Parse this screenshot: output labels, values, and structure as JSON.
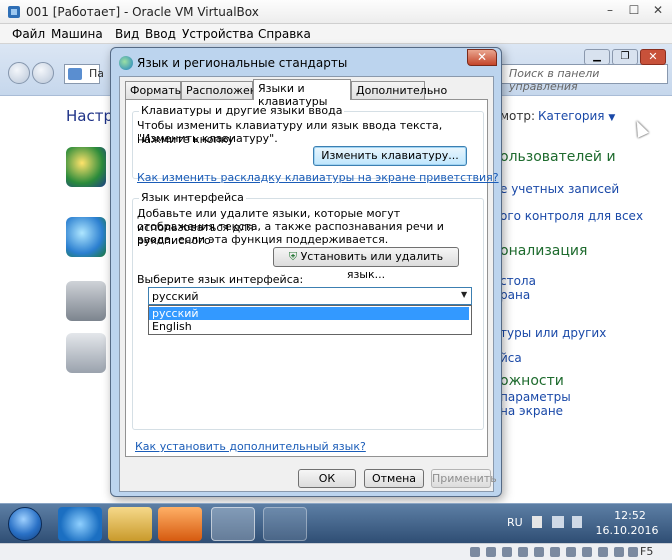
{
  "vbox": {
    "title": "001 [Работает] - Oracle VM VirtualBox",
    "menu": [
      "Файл",
      "Машина",
      "Вид",
      "Ввод",
      "Устройства",
      "Справка"
    ],
    "host_key": "F5"
  },
  "control_panel": {
    "address": "Па",
    "search_placeholder": "Поиск в панели управления",
    "heading": "Настро",
    "view_by": "мотр:",
    "view_by_value": "Категория",
    "right_items": [
      {
        "text": "ользователей и",
        "kind": "head"
      },
      {
        "text": "е учетных записей",
        "kind": "link"
      },
      {
        "text": "ого контроля для всех",
        "kind": "link"
      },
      {
        "text": "онализация",
        "kind": "head"
      },
      {
        "text": "стола",
        "kind": "link"
      },
      {
        "text": "рана",
        "kind": "link"
      },
      {
        "text": "",
        "kind": "link"
      },
      {
        "text": "туры или других",
        "kind": "link"
      },
      {
        "text": "йса",
        "kind": "link"
      },
      {
        "text": "ожности",
        "kind": "head"
      },
      {
        "text": "параметры",
        "kind": "link"
      },
      {
        "text": "на экране",
        "kind": "link"
      }
    ]
  },
  "dialog": {
    "title": "Язык и региональные стандарты",
    "tabs": [
      "Форматы",
      "Расположение",
      "Языки и клавиатуры",
      "Дополнительно"
    ],
    "active_tab": 2,
    "kb_group": {
      "title": "Клавиатуры и другие языки ввода",
      "text_line1": "Чтобы изменить клавиатуру или язык ввода текста, нажмите кнопку",
      "text_line2": "\"Изменить клавиатуру\".",
      "button": "Изменить клавиатуру...",
      "link": "Как изменить раскладку клавиатуры на экране приветствия?"
    },
    "ui_lang_group": {
      "title": "Язык интерфейса",
      "text_line1": "Добавьте или удалите языки, которые могут использоваться для",
      "text_line2": "отображения текста, а также распознавания речи и рукописного",
      "text_line3": "ввода, если эта функция поддерживается.",
      "button": "Установить или удалить язык...",
      "select_label": "Выберите язык интерфейса:",
      "selected": "русский",
      "options": [
        "русский",
        "English"
      ]
    },
    "bottom_link": "Как установить дополнительный язык?",
    "buttons": {
      "ok": "ОК",
      "cancel": "Отмена",
      "apply": "Применить"
    }
  },
  "taskbar": {
    "lang": "RU",
    "time": "12:52",
    "date": "16.10.2016"
  },
  "colors": {
    "link": "#1a5cb8",
    "dialog_frame": "#bcd4ee",
    "selection": "#3399ff",
    "taskbar": "#2f4e74"
  }
}
